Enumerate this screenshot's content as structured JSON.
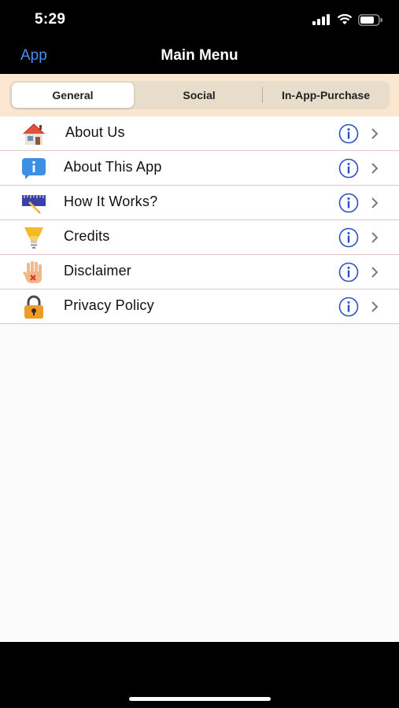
{
  "status": {
    "time": "5:29"
  },
  "nav": {
    "back_label": "App",
    "title": "Main Menu"
  },
  "tabs": [
    {
      "label": "General",
      "selected": true
    },
    {
      "label": "Social",
      "selected": false
    },
    {
      "label": "In-App-Purchase",
      "selected": false
    }
  ],
  "menu": [
    {
      "label": "About Us",
      "icon": "house-icon"
    },
    {
      "label": "About This App",
      "icon": "info-chat-icon"
    },
    {
      "label": "How It Works?",
      "icon": "pencil-ruler-icon"
    },
    {
      "label": "Credits",
      "icon": "lightbulb-icon"
    },
    {
      "label": "Disclaimer",
      "icon": "hand-stop-icon"
    },
    {
      "label": "Privacy Policy",
      "icon": "padlock-icon"
    }
  ],
  "colors": {
    "accent": "#4a8ff0",
    "info_blue": "#2a4fc4",
    "segment_bg": "#fbe7cf",
    "divider": "#e4c6c8"
  }
}
